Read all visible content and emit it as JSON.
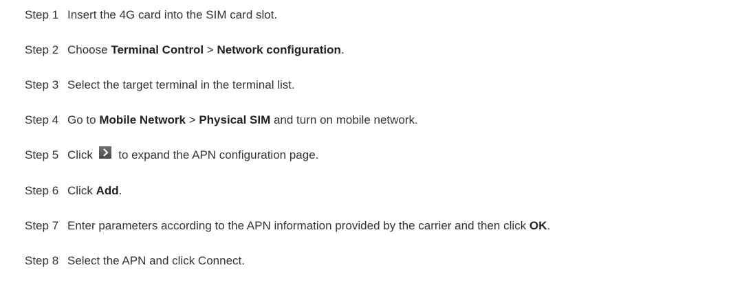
{
  "steps": [
    {
      "num": "Step 1",
      "parts": [
        {
          "text": "Insert the 4G card into the SIM card slot.",
          "bold": false
        }
      ]
    },
    {
      "num": "Step 2",
      "parts": [
        {
          "text": "Choose ",
          "bold": false
        },
        {
          "text": "Terminal Control",
          "bold": true
        },
        {
          "text": " > ",
          "bold": false
        },
        {
          "text": "Network configuration",
          "bold": true
        },
        {
          "text": ".",
          "bold": false
        }
      ]
    },
    {
      "num": "Step 3",
      "parts": [
        {
          "text": "Select the target terminal in the terminal list.",
          "bold": false
        }
      ]
    },
    {
      "num": "Step 4",
      "parts": [
        {
          "text": "Go to ",
          "bold": false
        },
        {
          "text": "Mobile Network",
          "bold": true
        },
        {
          "text": " > ",
          "bold": false
        },
        {
          "text": "Physical SIM",
          "bold": true
        },
        {
          "text": " and turn on mobile network.",
          "bold": false
        }
      ]
    },
    {
      "num": "Step 5",
      "parts": [
        {
          "text": "Click ",
          "bold": false
        },
        {
          "icon": "chevron-right-icon"
        },
        {
          "text": " to expand the APN configuration page.",
          "bold": false
        }
      ]
    },
    {
      "num": "Step 6",
      "parts": [
        {
          "text": "Click ",
          "bold": false
        },
        {
          "text": "Add",
          "bold": true
        },
        {
          "text": ".",
          "bold": false
        }
      ]
    },
    {
      "num": "Step 7",
      "parts": [
        {
          "text": "Enter parameters according to the APN information provided by the carrier and then click ",
          "bold": false
        },
        {
          "text": "OK",
          "bold": true
        },
        {
          "text": ".",
          "bold": false
        }
      ]
    },
    {
      "num": "Step 8",
      "parts": [
        {
          "text": "Select the APN and click Connect.",
          "bold": false
        }
      ]
    }
  ]
}
